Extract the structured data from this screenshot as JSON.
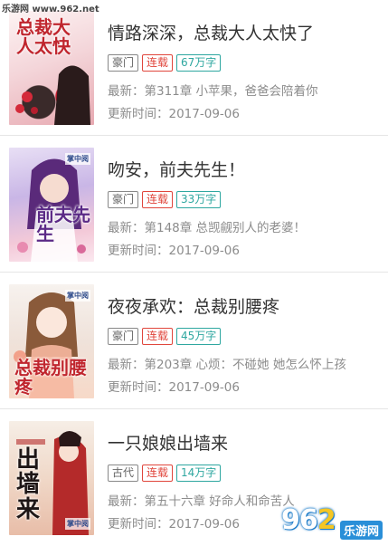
{
  "watermark": {
    "text": "乐游网 www.962.net"
  },
  "books": [
    {
      "title": "情路深深，总裁大人太快了",
      "cover_text": "总裁大人太快",
      "cover_brand": "",
      "tags": {
        "genre": "豪门",
        "status": "连载",
        "words": "67万字"
      },
      "latest": "最新：第311章 小苹果，爸爸会陪着你",
      "updated": "更新时间：2017-09-06"
    },
    {
      "title": "吻安，前夫先生！",
      "cover_text": "前夫先生",
      "cover_brand": "掌中阅",
      "tags": {
        "genre": "豪门",
        "status": "连载",
        "words": "33万字"
      },
      "latest": "最新：第148章 总觊觎别人的老婆！",
      "updated": "更新时间：2017-09-06"
    },
    {
      "title": "夜夜承欢：总裁别腰疼",
      "cover_text": "总裁别腰疼",
      "cover_brand": "掌中阅",
      "tags": {
        "genre": "豪门",
        "status": "连载",
        "words": "45万字"
      },
      "latest": "最新：第203章 心烦：不碰她 她怎么怀上孩",
      "updated": "更新时间：2017-09-06"
    },
    {
      "title": "一只娘娘出墙来",
      "cover_text": "出墙来",
      "cover_brand": "掌中阅",
      "tags": {
        "genre": "古代",
        "status": "连载",
        "words": "14万字"
      },
      "latest": "最新：第五十六章 好命人和命苦人",
      "updated": "更新时间：2017-09-06"
    }
  ],
  "logo": {
    "number_a": "96",
    "number_b": "2",
    "site": "乐游网"
  },
  "colors": {
    "status": "#e0463c",
    "words": "#2ea7a0",
    "genre": "#888888",
    "meta": "#8c8c8c"
  }
}
